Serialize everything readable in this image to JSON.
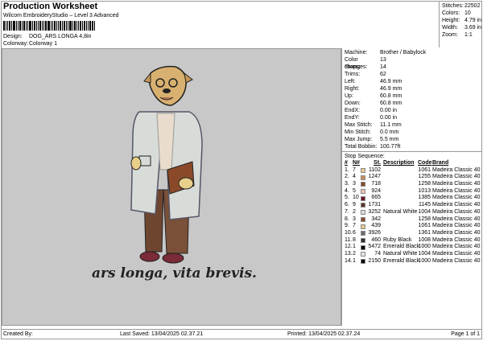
{
  "header": {
    "title": "Production Worksheet",
    "subtitle": "Wilcom EmbroideryStudio – Level 3 Advanced",
    "design_label": "Design:",
    "design_value": "DOG_ARS LONGA 4,8in",
    "colorway_label": "Colorway:",
    "colorway_value": "Colorway 1"
  },
  "stats": [
    {
      "k": "Stitches:",
      "v": "22502"
    },
    {
      "k": "Colors:",
      "v": "10"
    },
    {
      "k": "Height:",
      "v": "4.79 in"
    },
    {
      "k": "Width:",
      "v": "3.69 in"
    },
    {
      "k": "Zoom:",
      "v": "1:1"
    }
  ],
  "design": {
    "motto": "ars longa, vita brevis."
  },
  "info": [
    {
      "k": "Machine:",
      "v": "Brother / Babylock"
    },
    {
      "k": "Color changes:",
      "v": "13"
    },
    {
      "k": "Stops:",
      "v": "14"
    },
    {
      "k": "Trims:",
      "v": "62"
    },
    {
      "k": "Left:",
      "v": "46.9 mm"
    },
    {
      "k": "Right:",
      "v": "46.9 mm"
    },
    {
      "k": "Up:",
      "v": "60.8 mm"
    },
    {
      "k": "Down:",
      "v": "60.8 mm"
    },
    {
      "k": "EndX:",
      "v": "0.00 in"
    },
    {
      "k": "EndY:",
      "v": "0.00 in"
    },
    {
      "k": "Max Stitch:",
      "v": "11.1 mm"
    },
    {
      "k": "Min Stitch:",
      "v": "0.0 mm"
    },
    {
      "k": "Max Jump:",
      "v": "5.5 mm"
    },
    {
      "k": "Total Bobbin:",
      "v": "100.77ft"
    }
  ],
  "stop_sequence": {
    "title": "Stop Sequence:",
    "headers": [
      "#",
      "N#",
      "St.",
      "Description",
      "Code",
      "Brand"
    ],
    "rows": [
      [
        "1.",
        "7",
        "#e8c98e",
        "1102",
        "",
        "1061",
        "Madeira Classic 40"
      ],
      [
        "2.",
        "4",
        "#c8905a",
        "1247",
        "",
        "1255",
        "Madeira Classic 40"
      ],
      [
        "3.",
        "3",
        "#8a4a2a",
        "718",
        "",
        "1258",
        "Madeira Classic 40"
      ],
      [
        "4.",
        "5",
        "#ebc3bb",
        "924",
        "",
        "1013",
        "Madeira Classic 40"
      ],
      [
        "5.",
        "10",
        "#6a1628",
        "665",
        "",
        "1385",
        "Madeira Classic 40"
      ],
      [
        "6.",
        "9",
        "#5a3626",
        "1731",
        "",
        "1145",
        "Madeira Classic 40"
      ],
      [
        "7.",
        "2",
        "#dcdce2",
        "3252",
        "Natural White",
        "1004",
        "Madeira Classic 40"
      ],
      [
        "8.",
        "3",
        "#8a4a2a",
        "342",
        "",
        "1258",
        "Madeira Classic 40"
      ],
      [
        "9.",
        "7",
        "#e8c98e",
        "439",
        "",
        "1061",
        "Madeira Classic 40"
      ],
      [
        "10.",
        "6",
        "#6e6e6e",
        "3926",
        "",
        "1361",
        "Madeira Classic 40"
      ],
      [
        "11.",
        "8",
        "#2e2e2e",
        "460",
        "Ruby Black",
        "1008",
        "Madeira Classic 40"
      ],
      [
        "12.",
        "1",
        "#000000",
        "5472",
        "Emerald Black",
        "1000",
        "Madeira Classic 40"
      ],
      [
        "13.",
        "2",
        "#e6e6e6",
        "74",
        "Natural White",
        "1004",
        "Madeira Classic 40"
      ],
      [
        "14.",
        "1",
        "#000000",
        "2150",
        "Emerald Black",
        "1000",
        "Madeira Classic 40"
      ]
    ]
  },
  "footer": {
    "created": "Created By:",
    "saved": "Last Saved: 13/04/2025 02.37.21",
    "printed": "Printed: 13/04/2025 02.37.24",
    "page": "Page 1 of 1"
  }
}
